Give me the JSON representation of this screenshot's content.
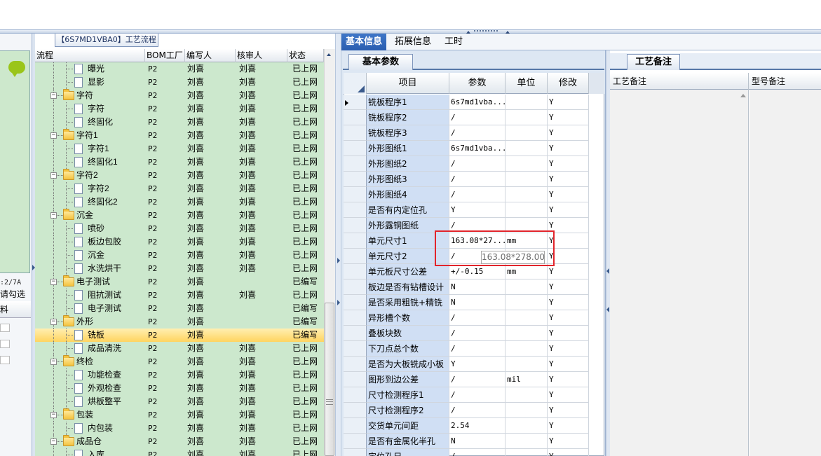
{
  "tree": {
    "title": "【6S7MD1VBA0】工艺流程",
    "columns": [
      "流程",
      "BOM工厂",
      "编写人",
      "核审人",
      "状态"
    ],
    "rows": [
      {
        "name": "曝光",
        "level": 2,
        "kind": "doc",
        "bom": "P2",
        "writer": "刘喜",
        "checker": "刘喜",
        "status": "已上网"
      },
      {
        "name": "显影",
        "level": 2,
        "kind": "doc",
        "bom": "P2",
        "writer": "刘喜",
        "checker": "刘喜",
        "status": "已上网"
      },
      {
        "name": "字符",
        "level": 1,
        "kind": "folder",
        "bom": "P2",
        "writer": "刘喜",
        "checker": "刘喜",
        "status": "已上网"
      },
      {
        "name": "字符",
        "level": 2,
        "kind": "doc",
        "bom": "P2",
        "writer": "刘喜",
        "checker": "刘喜",
        "status": "已上网"
      },
      {
        "name": "终固化",
        "level": 2,
        "kind": "doc",
        "bom": "P2",
        "writer": "刘喜",
        "checker": "刘喜",
        "status": "已上网"
      },
      {
        "name": "字符1",
        "level": 1,
        "kind": "folder",
        "bom": "P2",
        "writer": "刘喜",
        "checker": "刘喜",
        "status": "已上网"
      },
      {
        "name": "字符1",
        "level": 2,
        "kind": "doc",
        "bom": "P2",
        "writer": "刘喜",
        "checker": "刘喜",
        "status": "已上网"
      },
      {
        "name": "终固化1",
        "level": 2,
        "kind": "doc",
        "bom": "P2",
        "writer": "刘喜",
        "checker": "刘喜",
        "status": "已上网"
      },
      {
        "name": "字符2",
        "level": 1,
        "kind": "folder",
        "bom": "P2",
        "writer": "刘喜",
        "checker": "刘喜",
        "status": "已上网"
      },
      {
        "name": "字符2",
        "level": 2,
        "kind": "doc",
        "bom": "P2",
        "writer": "刘喜",
        "checker": "刘喜",
        "status": "已上网"
      },
      {
        "name": "终固化2",
        "level": 2,
        "kind": "doc",
        "bom": "P2",
        "writer": "刘喜",
        "checker": "刘喜",
        "status": "已上网"
      },
      {
        "name": "沉金",
        "level": 1,
        "kind": "folder",
        "bom": "P2",
        "writer": "刘喜",
        "checker": "刘喜",
        "status": "已上网"
      },
      {
        "name": "喷砂",
        "level": 2,
        "kind": "doc",
        "bom": "P2",
        "writer": "刘喜",
        "checker": "刘喜",
        "status": "已上网"
      },
      {
        "name": "板边包胶",
        "level": 2,
        "kind": "doc",
        "bom": "P2",
        "writer": "刘喜",
        "checker": "刘喜",
        "status": "已上网"
      },
      {
        "name": "沉金",
        "level": 2,
        "kind": "doc",
        "bom": "P2",
        "writer": "刘喜",
        "checker": "刘喜",
        "status": "已上网"
      },
      {
        "name": "水洗烘干",
        "level": 2,
        "kind": "doc",
        "bom": "P2",
        "writer": "刘喜",
        "checker": "刘喜",
        "status": "已上网"
      },
      {
        "name": "电子测试",
        "level": 1,
        "kind": "folder",
        "bom": "P2",
        "writer": "刘喜",
        "checker": "",
        "status": "已编写"
      },
      {
        "name": "阻抗测试",
        "level": 2,
        "kind": "doc",
        "bom": "P2",
        "writer": "刘喜",
        "checker": "刘喜",
        "status": "已上网"
      },
      {
        "name": "电子测试",
        "level": 2,
        "kind": "doc",
        "bom": "P2",
        "writer": "刘喜",
        "checker": "",
        "status": "已编写"
      },
      {
        "name": "外形",
        "level": 1,
        "kind": "folder",
        "bom": "P2",
        "writer": "刘喜",
        "checker": "",
        "status": "已编写"
      },
      {
        "name": "铣板",
        "level": 2,
        "kind": "doc",
        "bom": "P2",
        "writer": "刘喜",
        "checker": "",
        "status": "已编写",
        "selected": true
      },
      {
        "name": "成品清洗",
        "level": 2,
        "kind": "doc",
        "bom": "P2",
        "writer": "刘喜",
        "checker": "刘喜",
        "status": "已上网"
      },
      {
        "name": "终检",
        "level": 1,
        "kind": "folder",
        "bom": "P2",
        "writer": "刘喜",
        "checker": "刘喜",
        "status": "已上网"
      },
      {
        "name": "功能检查",
        "level": 2,
        "kind": "doc",
        "bom": "P2",
        "writer": "刘喜",
        "checker": "刘喜",
        "status": "已上网"
      },
      {
        "name": "外观检查",
        "level": 2,
        "kind": "doc",
        "bom": "P2",
        "writer": "刘喜",
        "checker": "刘喜",
        "status": "已上网"
      },
      {
        "name": "烘板整平",
        "level": 2,
        "kind": "doc",
        "bom": "P2",
        "writer": "刘喜",
        "checker": "刘喜",
        "status": "已上网"
      },
      {
        "name": "包装",
        "level": 1,
        "kind": "folder",
        "bom": "P2",
        "writer": "刘喜",
        "checker": "刘喜",
        "status": "已上网"
      },
      {
        "name": "内包装",
        "level": 2,
        "kind": "doc",
        "bom": "P2",
        "writer": "刘喜",
        "checker": "刘喜",
        "status": "已上网"
      },
      {
        "name": "成品仓",
        "level": 1,
        "kind": "folder",
        "bom": "P2",
        "writer": "刘喜",
        "checker": "刘喜",
        "status": "已上网"
      },
      {
        "name": "入库",
        "level": 2,
        "kind": "doc",
        "bom": "P2",
        "writer": "刘喜",
        "checker": "刘喜",
        "status": "已上网"
      }
    ]
  },
  "left_strip": {
    "fraction_text": ":2/7A",
    "check_text": "请勾选",
    "column_text": "料"
  },
  "main_tabs": [
    "基本信息",
    "拓展信息",
    "工时"
  ],
  "params": {
    "subtab": "基本参数",
    "columns": [
      "项目",
      "参数",
      "单位",
      "修改"
    ],
    "rows": [
      {
        "item": "铣板程序1",
        "param": "6s7md1vba...",
        "unit": "",
        "mod": "Y"
      },
      {
        "item": "铣板程序2",
        "param": "/",
        "unit": "",
        "mod": "Y"
      },
      {
        "item": "铣板程序3",
        "param": "/",
        "unit": "",
        "mod": "Y"
      },
      {
        "item": "外形图纸1",
        "param": "6s7md1vba...",
        "unit": "",
        "mod": "Y"
      },
      {
        "item": "外形图纸2",
        "param": "/",
        "unit": "",
        "mod": "Y"
      },
      {
        "item": "外形图纸3",
        "param": "/",
        "unit": "",
        "mod": "Y"
      },
      {
        "item": "外形图纸4",
        "param": "/",
        "unit": "",
        "mod": "Y"
      },
      {
        "item": "是否有内定位孔",
        "param": "Y",
        "unit": "",
        "mod": "Y"
      },
      {
        "item": "外形露铜图纸",
        "param": "/",
        "unit": "",
        "mod": "Y"
      },
      {
        "item": "单元尺寸1",
        "param": "163.08*27...",
        "unit": "mm",
        "mod": "Y"
      },
      {
        "item": "单元尺寸2",
        "param": "/",
        "unit": "",
        "mod": "Y"
      },
      {
        "item": "单元板尺寸公差",
        "param": "+/-0.15",
        "unit": "mm",
        "mod": "Y"
      },
      {
        "item": "板边是否有钻槽设计",
        "param": "N",
        "unit": "",
        "mod": "Y"
      },
      {
        "item": "是否采用粗铣+精铣",
        "param": "N",
        "unit": "",
        "mod": "Y"
      },
      {
        "item": "异形槽个数",
        "param": "/",
        "unit": "",
        "mod": "Y"
      },
      {
        "item": "叠板块数",
        "param": "/",
        "unit": "",
        "mod": "Y"
      },
      {
        "item": "下刀点总个数",
        "param": "/",
        "unit": "",
        "mod": "Y"
      },
      {
        "item": "是否为大板铣成小板",
        "param": "Y",
        "unit": "",
        "mod": "Y"
      },
      {
        "item": "图形到边公差",
        "param": "/",
        "unit": "mil",
        "mod": "Y"
      },
      {
        "item": "尺寸检测程序1",
        "param": "/",
        "unit": "",
        "mod": "Y"
      },
      {
        "item": "尺寸检测程序2",
        "param": "/",
        "unit": "",
        "mod": "Y"
      },
      {
        "item": "交货单元间距",
        "param": "2.54",
        "unit": "",
        "mod": "Y"
      },
      {
        "item": "是否有金属化半孔",
        "param": "N",
        "unit": "",
        "mod": "Y"
      },
      {
        "item": "定位孔尺",
        "param": "/",
        "unit": "",
        "mod": "Y"
      }
    ],
    "tooltip": "163.08*278.00"
  },
  "remarks": {
    "tab": "工艺备注",
    "columns": [
      "工艺备注",
      "型号备注"
    ]
  }
}
